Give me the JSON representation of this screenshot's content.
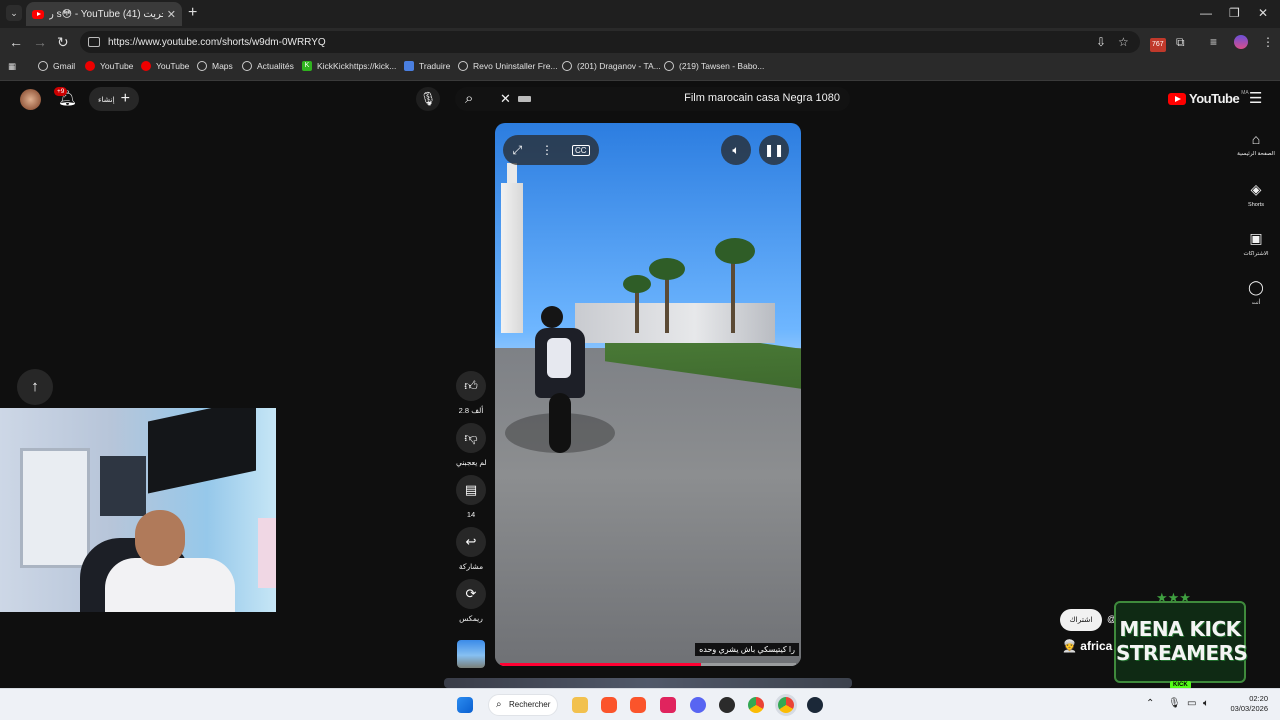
{
  "browser": {
    "tab_title": "ﺭ s😳 - YouTube جريت (41) 🔊",
    "tab_close": "✕",
    "new_tab": "+",
    "url": "https://www.youtube.com/shorts/w9dm-0WRRYQ",
    "bookmarks": [
      {
        "label": "Gmail",
        "icon": "globe-icon"
      },
      {
        "label": "YouTube",
        "icon": "youtube-icon"
      },
      {
        "label": "YouTube",
        "icon": "youtube-icon"
      },
      {
        "label": "Maps",
        "icon": "globe-icon"
      },
      {
        "label": "Actualités",
        "icon": "globe-icon"
      },
      {
        "label": "KickKickhttps://kick...",
        "icon": "kick-icon"
      },
      {
        "label": "Traduire",
        "icon": "translate-icon"
      },
      {
        "label": "Revo Uninstaller Fre...",
        "icon": "globe-icon"
      },
      {
        "label": "(201) Draganov - TA...",
        "icon": "globe-icon"
      },
      {
        "label": "(219) Tawsen - Babo...",
        "icon": "globe-icon"
      }
    ],
    "extension_badge": "767"
  },
  "youtube": {
    "notification_badge": "+9",
    "create_label": "إنشاء",
    "search_query": "Film marocain casa Negra 1080",
    "logo_text": "YouTube",
    "region": "MA",
    "sidebar": [
      {
        "label": "الصفحة الرئيسية",
        "icon": "home-icon"
      },
      {
        "label": "Shorts",
        "icon": "shorts-icon"
      },
      {
        "label": "الاشتراكات",
        "icon": "subscriptions-icon"
      },
      {
        "label": "أنت",
        "icon": "you-icon"
      }
    ],
    "actions": {
      "like_count": "2.8 ألف",
      "dislike_label": "لم يعجبني",
      "comments_count": "14",
      "share_label": "مشاركة",
      "remix_label": "ريمكس"
    },
    "video": {
      "caption": "را كيتيسكي باش يشري وحده",
      "progress": 0.68
    },
    "subscribe_label": "اشتراك",
    "channel_name": "africa",
    "channel_at": "@"
  },
  "overlay": {
    "logo_line1": "MENA KICK",
    "logo_line2": "STREAMERS",
    "logo_tag": "KICK",
    "stars": "★★★"
  },
  "taskbar": {
    "search_label": "Rechercher",
    "time": "02:20",
    "date": "03/03/2026"
  },
  "colors": {
    "yt_red": "#ff0000",
    "progress_red": "#ff0033",
    "kick_green": "#53fc18"
  }
}
